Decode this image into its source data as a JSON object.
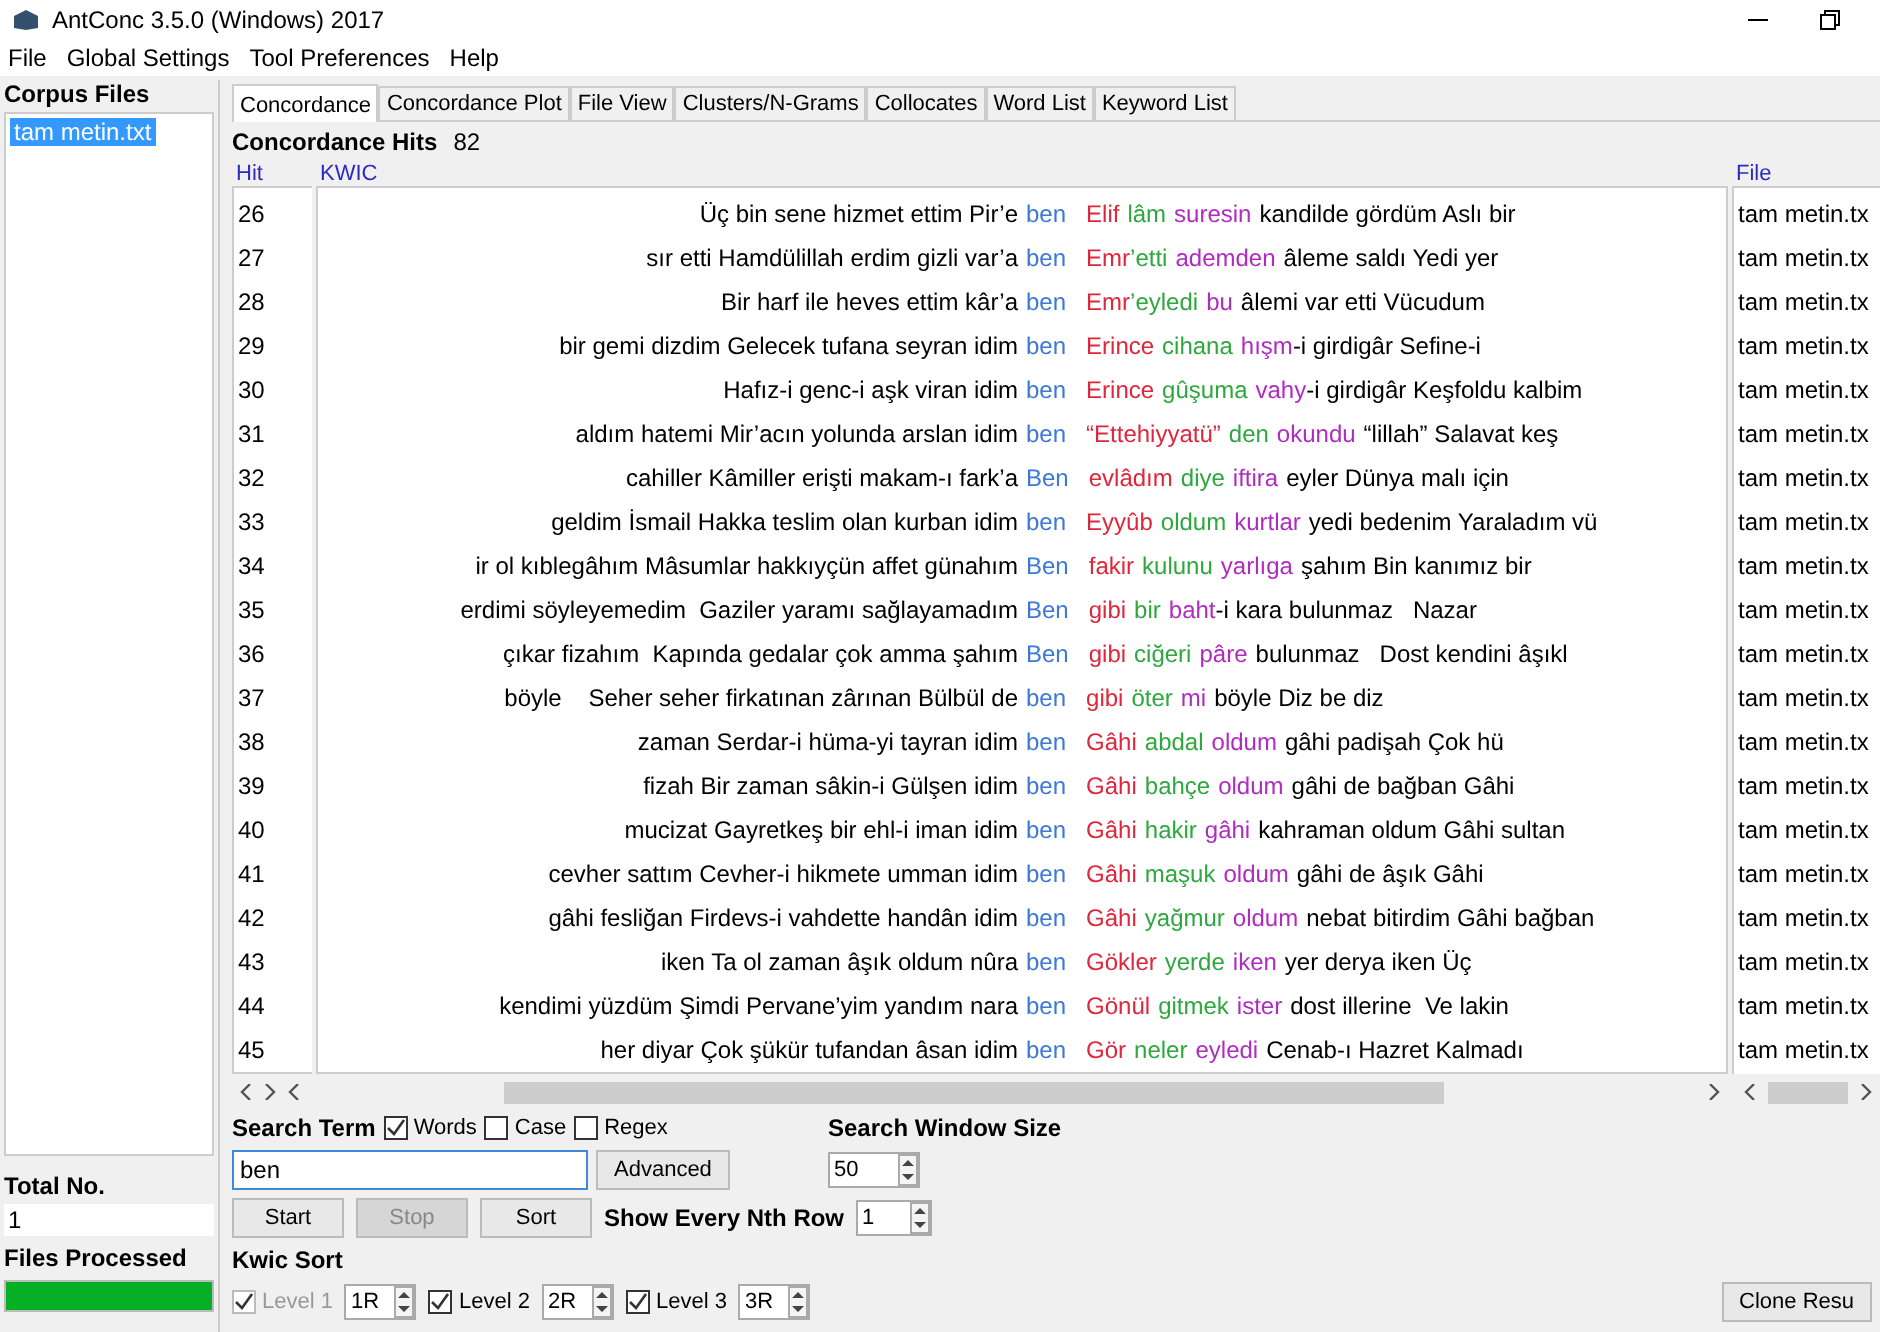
{
  "window": {
    "title": "AntConc 3.5.0 (Windows) 2017"
  },
  "menu": [
    "File",
    "Global Settings",
    "Tool Preferences",
    "Help"
  ],
  "sidebar": {
    "title": "Corpus Files",
    "files": [
      {
        "name": "tam metin.txt",
        "selected": true
      }
    ],
    "total_label": "Total No.",
    "total_value": "1",
    "processed_label": "Files Processed",
    "processed": {
      "level": 1
    }
  },
  "tabs": [
    {
      "label": "Concordance",
      "selected": true
    },
    {
      "label": "Concordance Plot",
      "selected": false
    },
    {
      "label": "File View",
      "selected": false
    },
    {
      "label": "Clusters/N-Grams",
      "selected": false
    },
    {
      "label": "Collocates",
      "selected": false
    },
    {
      "label": "Word List",
      "selected": false
    },
    {
      "label": "Keyword List",
      "selected": false
    }
  ],
  "hits": {
    "label": "Concordance Hits",
    "value": "82"
  },
  "table": {
    "columns": [
      "Hit",
      "KWIC",
      "File"
    ],
    "rows": [
      {
        "hit": "26",
        "left": "Üç bin sene hizmet ettim Pir’e",
        "node": "ben",
        "words": [
          {
            "text": "Elif",
            "kind": "first"
          },
          {
            "text": "lâm",
            "kind": "second"
          },
          {
            "text": "suresin",
            "kind": "third"
          },
          {
            "text": "kandilde gördüm Aslı bir",
            "kind": "plain"
          }
        ],
        "file": "tam metin.tx"
      },
      {
        "hit": "27",
        "left": "sır etti Hamdülillah erdim gizli var’a",
        "node": "ben",
        "words": [
          {
            "text": "Emr",
            "kind": "first"
          },
          {
            "text": "’etti",
            "kind": "second",
            "joined": true
          },
          {
            "text": "ademden",
            "kind": "third"
          },
          {
            "text": "âleme saldı Yedi yer",
            "kind": "plain"
          }
        ],
        "file": "tam metin.tx"
      },
      {
        "hit": "28",
        "left": "Bir harf ile heves ettim kâr’a",
        "node": "ben",
        "words": [
          {
            "text": "Emr",
            "kind": "first"
          },
          {
            "text": "’eyledi",
            "kind": "second",
            "joined": true
          },
          {
            "text": "bu",
            "kind": "third"
          },
          {
            "text": "âlemi var etti Vücudum",
            "kind": "plain"
          }
        ],
        "file": "tam metin.tx"
      },
      {
        "hit": "29",
        "left": "bir gemi dizdim Gelecek tufana seyran idim",
        "node": "ben",
        "words": [
          {
            "text": "Erince",
            "kind": "first"
          },
          {
            "text": "cihana",
            "kind": "second"
          },
          {
            "text": "hışm",
            "kind": "third"
          },
          {
            "text": "-i girdigâr Sefine-i",
            "kind": "plain",
            "joined": true
          }
        ],
        "file": "tam metin.tx"
      },
      {
        "hit": "30",
        "left": "Hafız-i genc-i aşk viran idim",
        "node": "ben",
        "words": [
          {
            "text": "Erince",
            "kind": "first"
          },
          {
            "text": "gûşuma",
            "kind": "second"
          },
          {
            "text": "vahy",
            "kind": "third"
          },
          {
            "text": "-i girdigâr Keşfoldu kalbim",
            "kind": "plain",
            "joined": true
          }
        ],
        "file": "tam metin.tx"
      },
      {
        "hit": "31",
        "left": "aldım hatemi Mir’acın yolunda arslan idim",
        "node": "ben",
        "words": [
          {
            "text": "“Ettehiyyatü”",
            "kind": "first"
          },
          {
            "text": "den",
            "kind": "second"
          },
          {
            "text": "okundu",
            "kind": "third"
          },
          {
            "text": "“lillah” Salavat keş",
            "kind": "plain"
          }
        ],
        "file": "tam metin.tx"
      },
      {
        "hit": "32",
        "left": "cahiller Kâmiller erişti makam-ı fark’a",
        "node": "Ben",
        "words": [
          {
            "text": "evlâdım",
            "kind": "first"
          },
          {
            "text": "diye",
            "kind": "second"
          },
          {
            "text": "iftira",
            "kind": "third"
          },
          {
            "text": "eyler Dünya malı için",
            "kind": "plain"
          }
        ],
        "file": "tam metin.tx"
      },
      {
        "hit": "33",
        "left": "geldim İsmail Hakka teslim olan kurban idim",
        "node": "ben",
        "words": [
          {
            "text": "Eyyûb",
            "kind": "first"
          },
          {
            "text": "oldum",
            "kind": "second"
          },
          {
            "text": "kurtlar",
            "kind": "third"
          },
          {
            "text": "yedi bedenim Yaraladım vü",
            "kind": "plain"
          }
        ],
        "file": "tam metin.tx"
      },
      {
        "hit": "34",
        "left": "ir ol kıblegâhım Mâsumlar hakkıyçün affet günahım",
        "node": "Ben",
        "words": [
          {
            "text": "fakir",
            "kind": "first"
          },
          {
            "text": "kulunu",
            "kind": "second"
          },
          {
            "text": "yarlıga",
            "kind": "third"
          },
          {
            "text": "şahım Bin kanımız bir",
            "kind": "plain"
          }
        ],
        "file": "tam metin.tx"
      },
      {
        "hit": "35",
        "left": "erdimi söyleyemedim  Gaziler yaramı sağlayamadım",
        "node": "Ben",
        "words": [
          {
            "text": "gibi",
            "kind": "first"
          },
          {
            "text": "bir",
            "kind": "second"
          },
          {
            "text": "baht",
            "kind": "third"
          },
          {
            "text": "-i kara bulunmaz   Nazar",
            "kind": "plain",
            "joined": true
          }
        ],
        "file": "tam metin.tx"
      },
      {
        "hit": "36",
        "left": "çıkar fizahım  Kapında gedalar çok amma şahım",
        "node": "Ben",
        "words": [
          {
            "text": "gibi",
            "kind": "first"
          },
          {
            "text": "ciğeri",
            "kind": "second"
          },
          {
            "text": "pâre",
            "kind": "third"
          },
          {
            "text": "bulunmaz   Dost kendini âşıkl",
            "kind": "plain"
          }
        ],
        "file": "tam metin.tx"
      },
      {
        "hit": "37",
        "left": "böyle    Seher seher firkatınan zârınan Bülbül de",
        "node": "ben",
        "words": [
          {
            "text": "gibi",
            "kind": "first"
          },
          {
            "text": "öter",
            "kind": "second"
          },
          {
            "text": "mi",
            "kind": "third"
          },
          {
            "text": "böyle Diz be diz",
            "kind": "plain"
          }
        ],
        "file": "tam metin.tx"
      },
      {
        "hit": "38",
        "left": "zaman Serdar-i hüma-yi tayran idim",
        "node": "ben",
        "words": [
          {
            "text": "Gâhi",
            "kind": "first"
          },
          {
            "text": "abdal",
            "kind": "second"
          },
          {
            "text": "oldum",
            "kind": "third"
          },
          {
            "text": "gâhi padişah Çok hü",
            "kind": "plain"
          }
        ],
        "file": "tam metin.tx"
      },
      {
        "hit": "39",
        "left": "fizah Bir zaman sâkin-i Gülşen idim",
        "node": "ben",
        "words": [
          {
            "text": "Gâhi",
            "kind": "first"
          },
          {
            "text": "bahçe",
            "kind": "second"
          },
          {
            "text": "oldum",
            "kind": "third"
          },
          {
            "text": "gâhi de bağban Gâhi",
            "kind": "plain"
          }
        ],
        "file": "tam metin.tx"
      },
      {
        "hit": "40",
        "left": "mucizat Gayretkeş bir ehl-i iman idim",
        "node": "ben",
        "words": [
          {
            "text": "Gâhi",
            "kind": "first"
          },
          {
            "text": "hakir",
            "kind": "second"
          },
          {
            "text": "gâhi",
            "kind": "third"
          },
          {
            "text": "kahraman oldum Gâhi sultan",
            "kind": "plain"
          }
        ],
        "file": "tam metin.tx"
      },
      {
        "hit": "41",
        "left": "cevher sattım Cevher-i hikmete umman idim",
        "node": "ben",
        "words": [
          {
            "text": "Gâhi",
            "kind": "first"
          },
          {
            "text": "maşuk",
            "kind": "second"
          },
          {
            "text": "oldum",
            "kind": "third"
          },
          {
            "text": "gâhi de âşık Gâhi",
            "kind": "plain"
          }
        ],
        "file": "tam metin.tx"
      },
      {
        "hit": "42",
        "left": "gâhi fesliğan Firdevs-i vahdette handân idim",
        "node": "ben",
        "words": [
          {
            "text": "Gâhi",
            "kind": "first"
          },
          {
            "text": "yağmur",
            "kind": "second"
          },
          {
            "text": "oldum",
            "kind": "third"
          },
          {
            "text": "nebat bitirdim Gâhi bağban",
            "kind": "plain"
          }
        ],
        "file": "tam metin.tx"
      },
      {
        "hit": "43",
        "left": "iken Ta ol zaman âşık oldum nûra",
        "node": "ben",
        "words": [
          {
            "text": "Gökler",
            "kind": "first"
          },
          {
            "text": "yerde",
            "kind": "second"
          },
          {
            "text": "iken",
            "kind": "third"
          },
          {
            "text": "yer derya iken Üç",
            "kind": "plain"
          }
        ],
        "file": "tam metin.tx"
      },
      {
        "hit": "44",
        "left": "kendimi yüzdüm Şimdi Pervane’yim yandım nara",
        "node": "ben",
        "words": [
          {
            "text": "Gönül",
            "kind": "first"
          },
          {
            "text": "gitmek",
            "kind": "second"
          },
          {
            "text": "ister",
            "kind": "third"
          },
          {
            "text": "dost illerine  Ve lakin",
            "kind": "plain"
          }
        ],
        "file": "tam metin.tx"
      },
      {
        "hit": "45",
        "left": "her diyar Çok şükür tufandan âsan idim",
        "node": "ben",
        "words": [
          {
            "text": "Gör",
            "kind": "first"
          },
          {
            "text": "neler",
            "kind": "second"
          },
          {
            "text": "eyledi",
            "kind": "third"
          },
          {
            "text": "Cenab-ı Hazret Kalmadı",
            "kind": "plain"
          }
        ],
        "file": "tam metin.tx"
      }
    ]
  },
  "search": {
    "label": "Search Term",
    "options": [
      {
        "label": "Words",
        "checked": true
      },
      {
        "label": "Case",
        "checked": false
      },
      {
        "label": "Regex",
        "checked": false
      }
    ],
    "value": "ben",
    "advanced": "Advanced",
    "window_label": "Search Window Size",
    "window_value": "50"
  },
  "actions": [
    {
      "label": "Start",
      "disabled": false
    },
    {
      "label": "Stop",
      "disabled": true
    },
    {
      "label": "Sort",
      "disabled": false
    }
  ],
  "nth_row": {
    "label": "Show Every Nth Row",
    "value": "1"
  },
  "kwic_sort": {
    "label": "Kwic Sort",
    "levels": [
      {
        "label": "Level 1",
        "checked": true,
        "disabled": true,
        "value": "1R"
      },
      {
        "label": "Level 2",
        "checked": true,
        "disabled": false,
        "value": "2R"
      },
      {
        "label": "Level 3",
        "checked": true,
        "disabled": false,
        "value": "3R"
      }
    ]
  },
  "clone_button": "Clone Resu"
}
